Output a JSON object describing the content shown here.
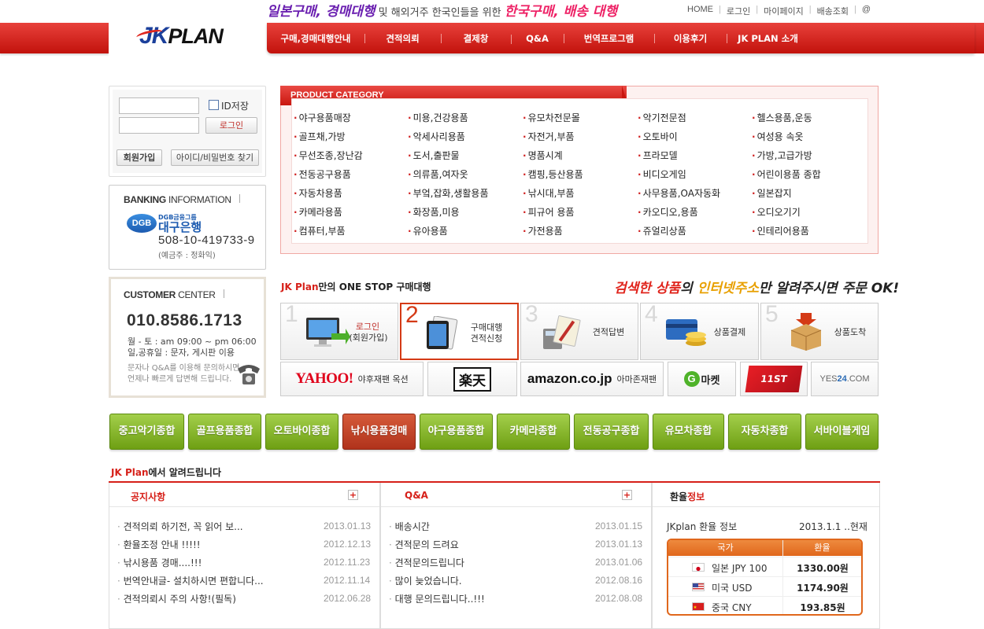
{
  "header": {
    "banner": {
      "part1": "일본구매, 경매대행",
      "part2": " 및 해외거주 한국인들을 위한 ",
      "part3": "한국구매, 배송 대행"
    },
    "logo": {
      "jk": "JK",
      "plan": "PLAN"
    },
    "topnav": [
      "HOME",
      "로그인",
      "마이페이지",
      "배송조회",
      "@"
    ],
    "mainnav": [
      "구매,경매대행안내",
      "견적의뢰",
      "결제창",
      "Q&A",
      "번역프로그램",
      "이용후기",
      "JK PLAN 소개"
    ],
    "accent_color": "#d62019"
  },
  "login": {
    "id_placeholder": "",
    "pw_placeholder": "",
    "save_id_label": "ID저장",
    "login_button": "로그인",
    "join_button": "회원가입",
    "find_button": "아이디/비밀번호 찾기"
  },
  "banking": {
    "title_bold": "BANKING",
    "title_light": " INFORMATION",
    "bank_logo": "DGB",
    "bank_group": "DGB금융그룹",
    "bank_name": "대구은행",
    "account_no": "508-10-419733-9",
    "account_owner": "(예금주 : 정화익)"
  },
  "customer": {
    "title_bold": "CUSTOMER",
    "title_light": " CENTER",
    "phone": "010.8586.1713",
    "hours1": "월 - 토 : am 09:00 ~ pm 06:00",
    "hours2": "일,공휴일 : 문자, 게시판 이용",
    "note1": "문자나 Q&A를 이용해 문의하시면",
    "note2": "언제나 빠르게 답변해 드립니다."
  },
  "category": {
    "title": "PRODUCT CATEGORY",
    "columns": [
      [
        "야구용품매장",
        "골프채,가방",
        "무선조종,장난감",
        "전동공구용품",
        "자동차용품",
        "카메라용품",
        "컴퓨터,부품"
      ],
      [
        "미용,건강용품",
        "악세사리용품",
        "도서,출판물",
        "의류품,여자옷",
        "부엌,잡화,생활용품",
        "화장품,미용",
        "유아용품"
      ],
      [
        "유모차전문몰",
        "자전거,부품",
        "명품시계",
        "캠핑,등산용품",
        "낚시대,부품",
        "피규어 용품",
        "가전용품"
      ],
      [
        "악기전문점",
        "오토바이",
        "프라모델",
        "비디오게임",
        "사무용품,OA자동화",
        "카오디오,용품",
        "쥬얼리상품"
      ],
      [
        "헬스용품,운동",
        "여성용 속옷",
        "가방,고급가방",
        "어린이용품 종합",
        "일본잡지",
        "오디오기기",
        "인테리어용품"
      ]
    ]
  },
  "onestop": {
    "brand": "JK Plan",
    "title_rest": "만의 ONE STOP 구매대행",
    "slogan_a": "검색한 상품",
    "slogan_b": "의 ",
    "slogan_c": "인터넷주소",
    "slogan_d": "만 알려주시면 ",
    "slogan_e": "주문 OK!",
    "steps": [
      {
        "num": "1",
        "line1": "로그인",
        "line2": "(회원가입)"
      },
      {
        "num": "2",
        "line1": "구매대행",
        "line2": "견적신청"
      },
      {
        "num": "3",
        "line1": "견적답변",
        "line2": ""
      },
      {
        "num": "4",
        "line1": "상품결제",
        "line2": ""
      },
      {
        "num": "5",
        "line1": "상품도착",
        "line2": ""
      }
    ],
    "stores": {
      "yahoo": "YAHOO!",
      "yahoo_sub": "야후재팬 옥션",
      "rakuten": "楽天",
      "amazon": "amazon.co.jp",
      "amazon_sub": "아마존재팬",
      "gmarket_g": "G",
      "gmarket": "마켓",
      "st11": "11ST",
      "yes24_a": "YES",
      "yes24_b": "24",
      "yes24_c": ".COM"
    }
  },
  "quick_categories": [
    "중고악기종합",
    "골프용품종합",
    "오토바이종합",
    "낚시용품경매",
    "야구용품종합",
    "카메라종합",
    "전동공구종합",
    "유모차종합",
    "자동차종합",
    "서바이블게임"
  ],
  "notices": {
    "title_brand": "JK Plan",
    "title_rest": "에서 알려드립니다",
    "notice_board": {
      "title": "공지사항",
      "posts": [
        {
          "text": "견적의뢰 하기전, 꼭 읽어 보...",
          "date": "2013.01.13"
        },
        {
          "text": "환율조정 안내 !!!!!",
          "date": "2012.12.13"
        },
        {
          "text": "낚시용품 경매....!!!",
          "date": "2012.11.23"
        },
        {
          "text": "번역안내글- 설치하시면 편합니다...",
          "date": "2012.11.14"
        },
        {
          "text": "견적의뢰시 주의 사항!(필독)",
          "date": "2012.06.28"
        }
      ]
    },
    "qna_board": {
      "title": "Q&A",
      "posts": [
        {
          "text": "배송시간",
          "date": "2013.01.15"
        },
        {
          "text": "견적문의 드려요",
          "date": "2013.01.13"
        },
        {
          "text": "견적문의드립니다",
          "date": "2013.01.06"
        },
        {
          "text": "많이 늦었습니다.",
          "date": "2012.08.16"
        },
        {
          "text": "대행 문의드립니다..!!!",
          "date": "2012.08.08"
        }
      ]
    },
    "exchange": {
      "title_a": "환율",
      "title_b": "정보",
      "info": "JKplan 환율 정보",
      "date": "2013.1.1 ..현재",
      "col_country": "국가",
      "col_rate": "환율",
      "rows": [
        {
          "name": "일본 JPY 100",
          "rate": "1330.00원",
          "flag": "jp"
        },
        {
          "name": "미국 USD",
          "rate": "1174.90원",
          "flag": "us"
        },
        {
          "name": "중국 CNY",
          "rate": "193.85원",
          "flag": "cn"
        }
      ]
    }
  }
}
